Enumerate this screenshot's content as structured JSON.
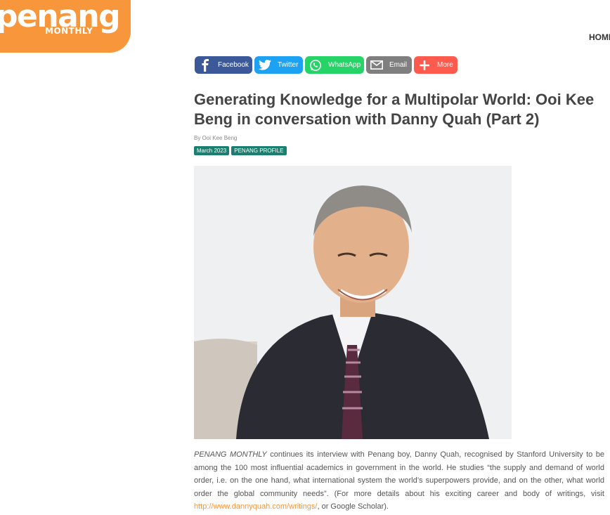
{
  "logo": {
    "word": "penang",
    "sub": "MONTHLY"
  },
  "nav": {
    "home": "HOME"
  },
  "share": {
    "facebook": "Facebook",
    "twitter": "Twitter",
    "whatsapp": "WhatsApp",
    "email": "Email",
    "more": "More"
  },
  "article": {
    "title": "Generating Knowledge for a Multipolar World: Ooi Kee Beng in conversation with Danny Quah (Part 2)",
    "byline": "By Ooi Kee Beng",
    "tags": [
      "March 2023",
      "PENANG PROFILE"
    ],
    "intro_em": "PENANG MONTHLY",
    "intro_text": " continues its interview with Penang boy, Danny Quah, recognised by Stanford University to be among the 100 most influential academics in government in the world. He studies “the supply and demand of world order, i.e. on the one hand, what international system the world’s superpowers provide, and on the other, what world order the global community needs”. (For more details about his exciting career and body of writings, visit ",
    "intro_link": "http://www.dannyquah.com/writings/",
    "intro_end": ", or Google Scholar)."
  },
  "colors": {
    "brand_orange": "#f7963b",
    "tag_green": "#1a7f6e",
    "facebook": "#3b5998",
    "twitter": "#1da1f2",
    "whatsapp": "#25d366",
    "email": "#7f7f7f",
    "more": "#ff5a4e"
  }
}
